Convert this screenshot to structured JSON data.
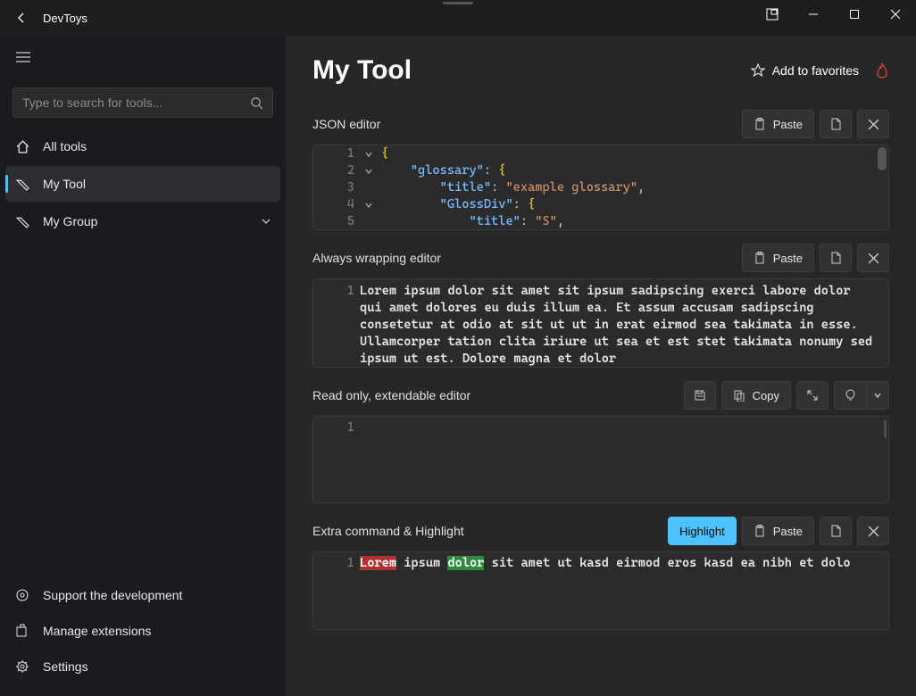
{
  "app": {
    "title": "DevToys"
  },
  "search": {
    "placeholder": "Type to search for tools..."
  },
  "nav": {
    "all_tools": "All tools",
    "my_tool": "My Tool",
    "my_group": "My Group"
  },
  "footer": {
    "support": "Support the development",
    "extensions": "Manage extensions",
    "settings": "Settings"
  },
  "page": {
    "title": "My Tool",
    "favorite_label": "Add to favorites"
  },
  "actions": {
    "paste": "Paste",
    "copy": "Copy",
    "highlight": "Highlight"
  },
  "sections": {
    "json_editor": {
      "title": "JSON editor",
      "lines": [
        {
          "n": 1,
          "fold": true,
          "indent": 0,
          "key": null,
          "open_brace": true
        },
        {
          "n": 2,
          "fold": true,
          "indent": 1,
          "key": "glossary",
          "open_brace_after": true
        },
        {
          "n": 3,
          "fold": false,
          "indent": 2,
          "key": "title",
          "value": "example glossary",
          "comma": true
        },
        {
          "n": 4,
          "fold": true,
          "indent": 2,
          "key": "GlossDiv",
          "open_brace_after": true
        },
        {
          "n": 5,
          "fold": false,
          "indent": 3,
          "key": "title",
          "value": "S",
          "comma": true
        }
      ]
    },
    "wrap_editor": {
      "title": "Always wrapping editor",
      "line_number": "1",
      "text": "Lorem ipsum dolor sit amet sit ipsum sadipscing exerci labore dolor qui amet dolores eu duis illum ea. Et assum accusam sadipscing consetetur at odio at sit ut ut in erat eirmod sea takimata in esse. Ullamcorper tation clita iriure ut sea et est stet takimata nonumy sed ipsum ut est. Dolore magna et dolor"
    },
    "readonly_editor": {
      "title": "Read only, extendable editor",
      "line_number": "1"
    },
    "highlight_editor": {
      "title": "Extra command & Highlight",
      "line_number": "1",
      "w1": "Lorem",
      "w2": "ipsum",
      "w3": "dolor",
      "rest": "sit amet ut kasd eirmod eros kasd ea nibh et dolo"
    }
  }
}
